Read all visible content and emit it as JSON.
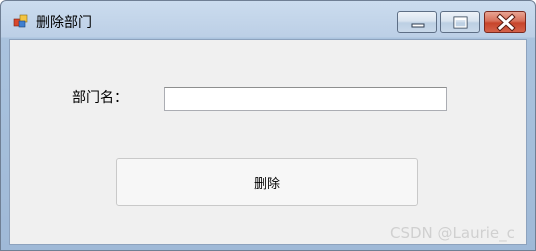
{
  "window": {
    "title": "删除部门",
    "app_icon": "windows-forms-app-icon",
    "controls": {
      "minimize_icon": "minimize-icon",
      "maximize_icon": "maximize-icon",
      "close_icon": "close-icon",
      "close_color": "#c7452b"
    }
  },
  "form": {
    "dept_name_label": "部门名：",
    "dept_name_value": "",
    "delete_button_label": "删除"
  },
  "watermark": "CSDN @Laurie_c"
}
